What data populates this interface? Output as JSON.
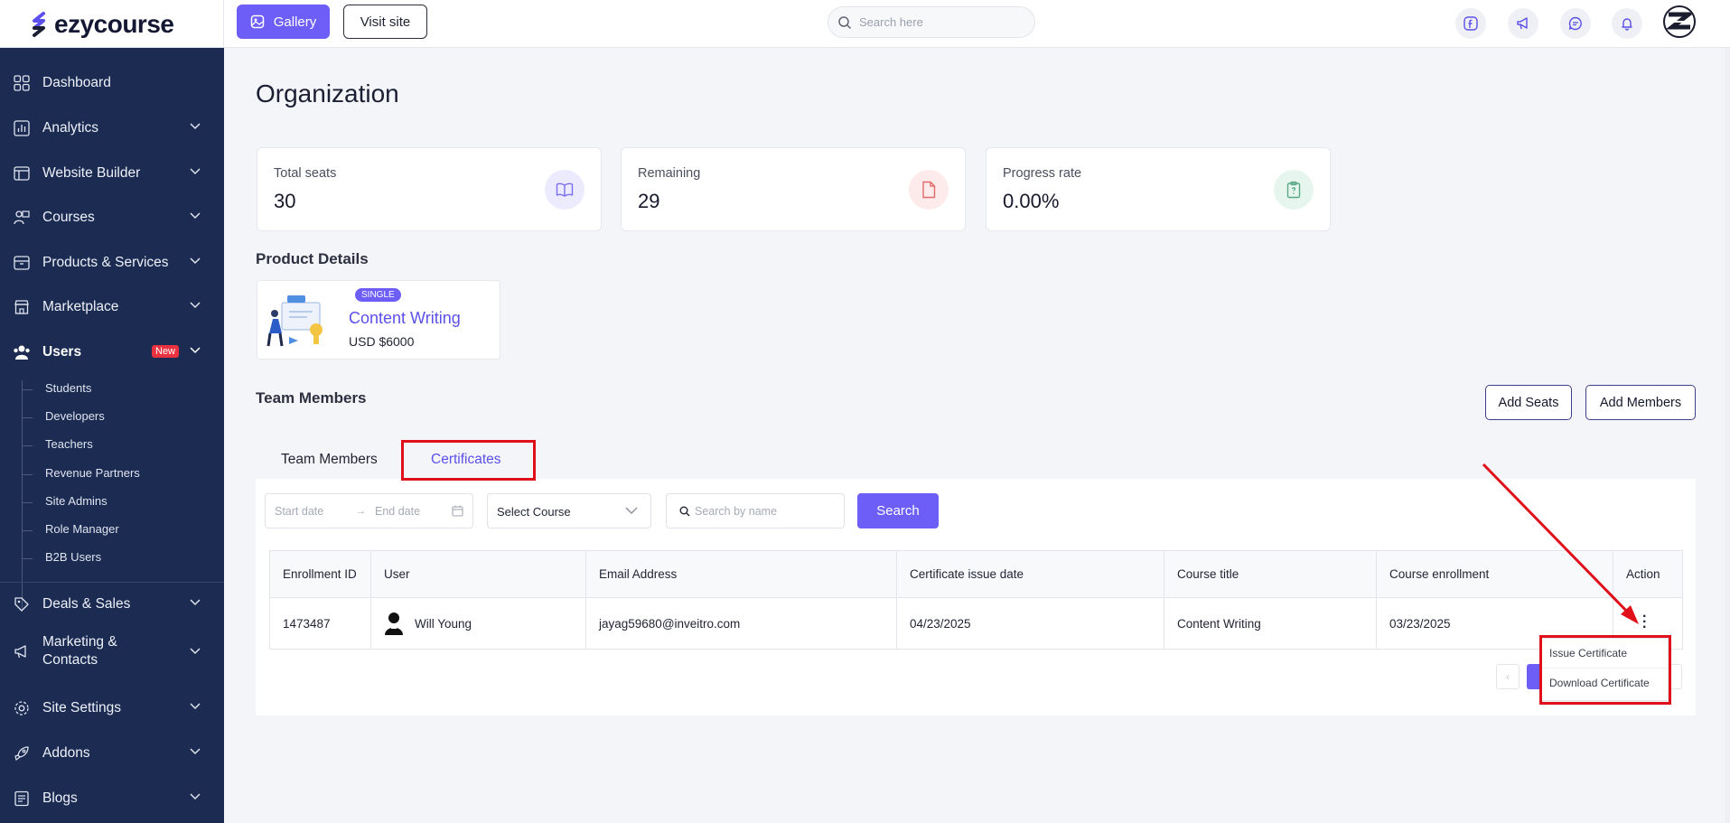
{
  "header": {
    "brand": "ezycourse",
    "gallery_label": "Gallery",
    "visit_site_label": "Visit site",
    "search_placeholder": "Search here",
    "icons": [
      "facebook-icon",
      "megaphone-icon",
      "chat-icon",
      "bell-icon"
    ]
  },
  "sidebar": {
    "items": [
      {
        "label": "Dashboard",
        "icon": "grid-icon"
      },
      {
        "label": "Analytics",
        "icon": "chart-icon"
      },
      {
        "label": "Website Builder",
        "icon": "browser-icon"
      },
      {
        "label": "Courses",
        "icon": "teacher-icon"
      },
      {
        "label": "Products & Services",
        "icon": "box-icon"
      },
      {
        "label": "Marketplace",
        "icon": "store-icon"
      },
      {
        "label": "Users",
        "icon": "users-icon",
        "badge": "New"
      },
      {
        "label": "Deals & Sales",
        "icon": "tag-icon"
      },
      {
        "label": "Marketing & Contacts",
        "line1": "Marketing &",
        "line2": "Contacts",
        "icon": "megaphone-icon"
      },
      {
        "label": "Site Settings",
        "icon": "gear-icon"
      },
      {
        "label": "Addons",
        "icon": "rocket-icon"
      },
      {
        "label": "Blogs",
        "icon": "document-icon"
      }
    ],
    "users_sub": [
      "Students",
      "Developers",
      "Teachers",
      "Revenue Partners",
      "Site Admins",
      "Role Manager",
      "B2B Users"
    ]
  },
  "main": {
    "title": "Organization",
    "stats": [
      {
        "label": "Total seats",
        "value": "30",
        "color": "#eceafd"
      },
      {
        "label": "Remaining",
        "value": "29",
        "color": "#fdeaea"
      },
      {
        "label": "Progress rate",
        "value": "0.00%",
        "color": "#e6f6ee"
      }
    ],
    "product_details_heading": "Product Details",
    "product": {
      "tag": "SINGLE",
      "name": "Content Writing",
      "price": "USD $6000"
    },
    "team_heading": "Team Members",
    "add_seats_label": "Add Seats",
    "add_members_label": "Add Members",
    "tabs": [
      {
        "label": "Team Members",
        "active": false
      },
      {
        "label": "Certificates",
        "active": true
      }
    ],
    "filters": {
      "start_date_placeholder": "Start date",
      "end_date_placeholder": "End date",
      "course_select": "Select Course",
      "search_placeholder": "Search by name",
      "search_button": "Search"
    },
    "table": {
      "columns": [
        "Enrollment ID",
        "User",
        "Email Address",
        "Certificate issue date",
        "Course title",
        "Course enrollment",
        "Action"
      ],
      "rows": [
        {
          "enrollment_id": "1473487",
          "user": "Will Young",
          "email": "jayag59680@inveitro.com",
          "issue_date": "04/23/2025",
          "course_title": "Content Writing",
          "enrollment_date": "03/23/2025"
        }
      ]
    },
    "action_menu": [
      "Issue Certificate",
      "Download Certificate"
    ]
  },
  "colors": {
    "accent": "#6d5ef7",
    "sidebar": "#1b2b52",
    "highlight": "#e0101b"
  }
}
